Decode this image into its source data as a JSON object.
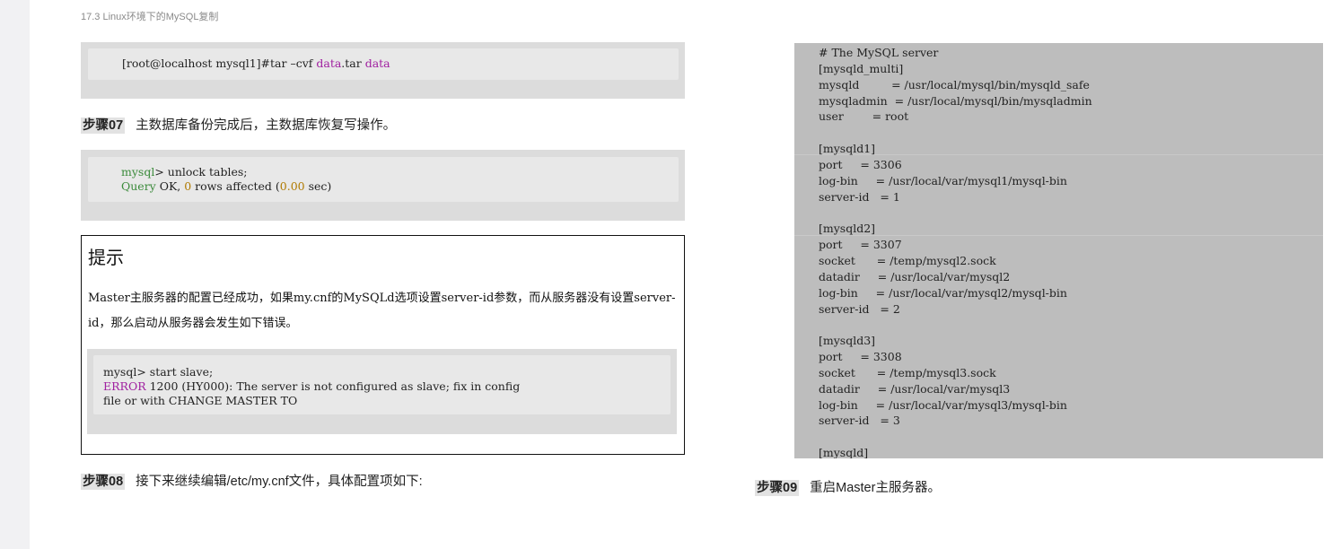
{
  "header": {
    "running_title": "17.3 Linux环境下的MySQL复制"
  },
  "code_tar": {
    "prompt": "[root@localhost mysql1]#tar –cvf ",
    "file": "data",
    "ext": ".tar ",
    "dir": "data"
  },
  "step07": {
    "tag": "步骤07",
    "text": "主数据库备份完成后，主数据库恢复写操作。"
  },
  "code_unlock": {
    "line1_kw": "mysql",
    "line1_rest": "> unlock tables;",
    "line2_kw": "Query",
    "line2_a": " OK, ",
    "line2_num": "0",
    "line2_b": " rows affected (",
    "line2_time": "0.00",
    "line2_c": " sec)"
  },
  "tip": {
    "title": "提示",
    "body": "Master主服务器的配置已经成功，如果my.cnf的MySQLd选项设置server-id参数，而从服务器没有设置server-id，那么启动从服务器会发生如下错误。",
    "code_line1": "mysql> start slave;",
    "code_err": "ERROR",
    "code_line2_rest": " 1200 (HY000): The server is not configured as slave; fix in config",
    "code_line3": "file or with CHANGE MASTER TO"
  },
  "step08": {
    "tag": "步骤08",
    "text": "接下来继续编辑/etc/my.cnf文件，具体配置项如下:"
  },
  "config": {
    "lines": [
      "# The MySQL server",
      "[mysqld_multi]",
      "mysqld         = /usr/local/mysql/bin/mysqld_safe",
      "mysqladmin  = /usr/local/mysql/bin/mysqladmin",
      "user        = root",
      "",
      "[mysqld1]",
      "port     = 3306",
      "log-bin     = /usr/local/var/mysql1/mysql-bin",
      "server-id   = 1",
      "",
      "[mysqld2]",
      "port     = 3307",
      "socket      = /temp/mysql2.sock",
      "datadir     = /usr/local/var/mysql2",
      "log-bin     = /usr/local/var/mysql2/mysql-bin",
      "server-id   = 2",
      "",
      "[mysqld3]",
      "port     = 3308",
      "socket      = /temp/mysql3.sock",
      "datadir     = /usr/local/var/mysql3",
      "log-bin     = /usr/local/var/mysql3/mysql-bin",
      "server-id   = 3",
      "",
      "[mysqld]"
    ]
  },
  "step09": {
    "tag": "步骤09",
    "text": "重启Master主服务器。"
  }
}
